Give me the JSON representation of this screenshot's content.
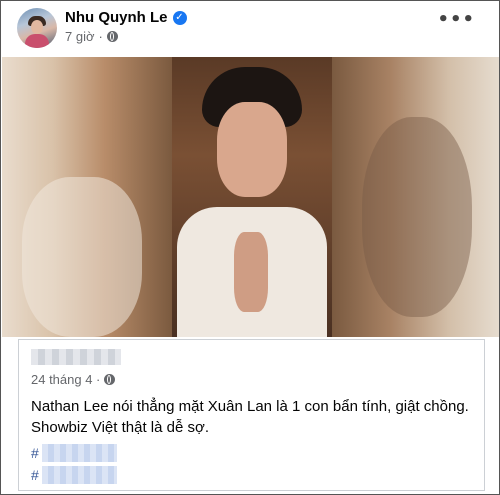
{
  "post": {
    "author": "Nhu Quynh Le",
    "time": "7 giờ",
    "verified_icon": "verified-badge-icon",
    "privacy_icon": "globe-icon",
    "more_label": "•••"
  },
  "shared": {
    "time": "24 tháng 4 ·",
    "text": "Nathan Lee nói thẳng mặt Xuân Lan là 1 con bẩn tính,  giật chồng. Showbiz Việt thật là dễ sợ.",
    "hashtags": [
      "#",
      "#"
    ]
  },
  "colors": {
    "link": "#385898",
    "verified": "#1877f2",
    "meta": "#65676b"
  }
}
